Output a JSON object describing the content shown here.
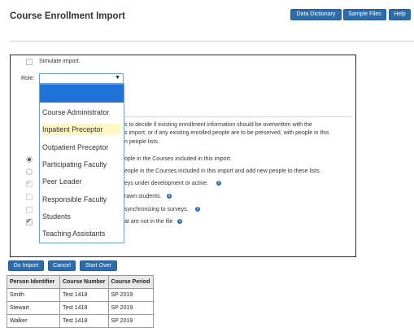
{
  "header": {
    "title": "Course Enrollment Import",
    "buttons": [
      "Data Dictionary",
      "Sample Files",
      "Help"
    ]
  },
  "panel": {
    "simulate_label": "Simulate import.",
    "role_label": "Role:",
    "role_selected": "",
    "dropdown_options": [
      "",
      "Course Administrator",
      "Inpatient Preceptor",
      "Outpatient Preceptor",
      "Participating Faculty",
      "Peer Leader",
      "Responsible Faculty",
      "Students",
      "Teaching Assistants"
    ],
    "desc_lines": [
      "s to decide if existing enrollment information should be overwritten with the",
      "s import, or if any existing enrolled people are to be preserved, with people in this",
      "n people lists."
    ],
    "options": [
      "ople in the Courses included in this import.",
      "eople in the Courses included in this import and add new people to these lists.",
      "eys under development or active.",
      "rawn students.",
      "synchronizing to surveys.",
      "at are not in the file"
    ]
  },
  "actions": [
    "Do Import",
    "Cancel",
    "Start Over"
  ],
  "table": {
    "headers": [
      "Person Identifier",
      "Course Number",
      "Course Period"
    ],
    "rows": [
      [
        "Smith",
        "Test 1418",
        "SP 2019"
      ],
      [
        "Stewart",
        "Test 1418",
        "SP 2019"
      ],
      [
        "Walker",
        "Test 1418",
        "SP 2019"
      ]
    ]
  },
  "colors": {
    "button_blue": "#2d6ca8",
    "selected_blue": "#1e72d8",
    "hover_yellow": "#fff8c6"
  },
  "icons": {
    "info": "info-circle-icon",
    "dropdown": "caret-down-icon"
  }
}
